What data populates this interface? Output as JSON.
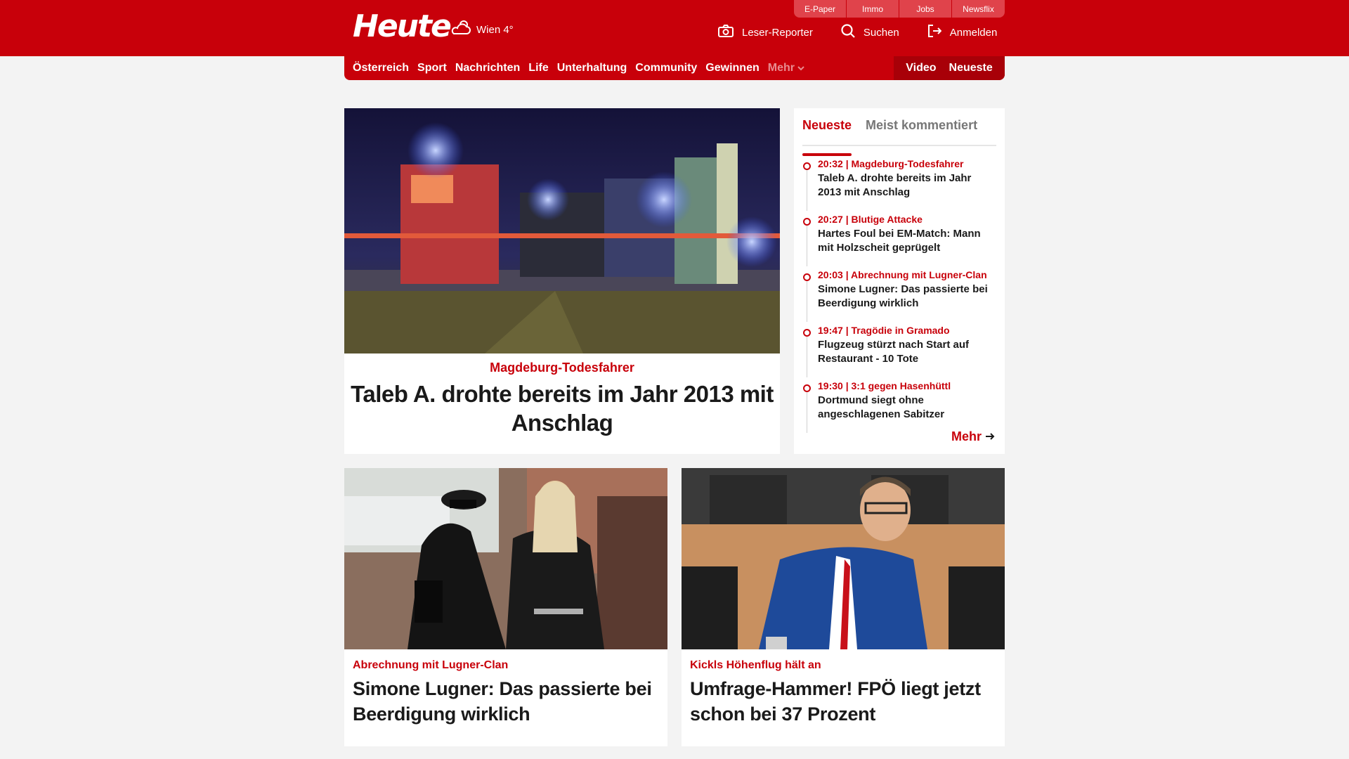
{
  "header": {
    "logo": "Heute",
    "weather": "Wien 4°",
    "util_tabs": [
      "E-Paper",
      "Immo",
      "Jobs",
      "Newsflix"
    ],
    "actions": [
      {
        "label": "Leser-Reporter",
        "icon": "camera-icon"
      },
      {
        "label": "Suchen",
        "icon": "search-icon"
      },
      {
        "label": "Anmelden",
        "icon": "login-icon"
      }
    ]
  },
  "nav": {
    "items": [
      "Österreich",
      "Sport",
      "Nachrichten",
      "Life",
      "Unterhaltung",
      "Community",
      "Gewinnen"
    ],
    "more": "Mehr",
    "right": [
      "Video",
      "Neueste"
    ]
  },
  "hero": {
    "kicker": "Magdeburg-Todesfahrer",
    "title": "Taleb A. drohte bereits im Jahr 2013 mit Anschlag"
  },
  "sidebar": {
    "tabs": [
      "Neueste",
      "Meist kommentiert"
    ],
    "items": [
      {
        "meta": "20:32 | Magdeburg-Todesfahrer",
        "title": "Taleb A. drohte bereits im Jahr 2013 mit Anschlag"
      },
      {
        "meta": "20:27 | Blutige Attacke",
        "title": "Hartes Foul bei EM-Match: Mann mit Holzscheit geprügelt"
      },
      {
        "meta": "20:03 | Abrechnung mit Lugner-Clan",
        "title": "Simone Lugner: Das passierte bei Beerdigung wirklich"
      },
      {
        "meta": "19:47 | Tragödie in Gramado",
        "title": "Flugzeug stürzt nach Start auf Restaurant - 10 Tote"
      },
      {
        "meta": "19:30 | 3:1 gegen Hasenhüttl",
        "title": "Dortmund siegt ohne angeschlagenen Sabitzer"
      }
    ],
    "more": "Mehr"
  },
  "cards": [
    {
      "kicker": "Abrechnung mit Lugner-Clan",
      "title": "Simone Lugner: Das passierte bei Beerdigung wirklich"
    },
    {
      "kicker": "Kickls Höhenflug hält an",
      "title": "Umfrage-Hammer! FPÖ liegt jetzt schon bei 37 Prozent"
    }
  ],
  "colors": {
    "brand": "#c8000a",
    "background": "#f3f3f3"
  }
}
